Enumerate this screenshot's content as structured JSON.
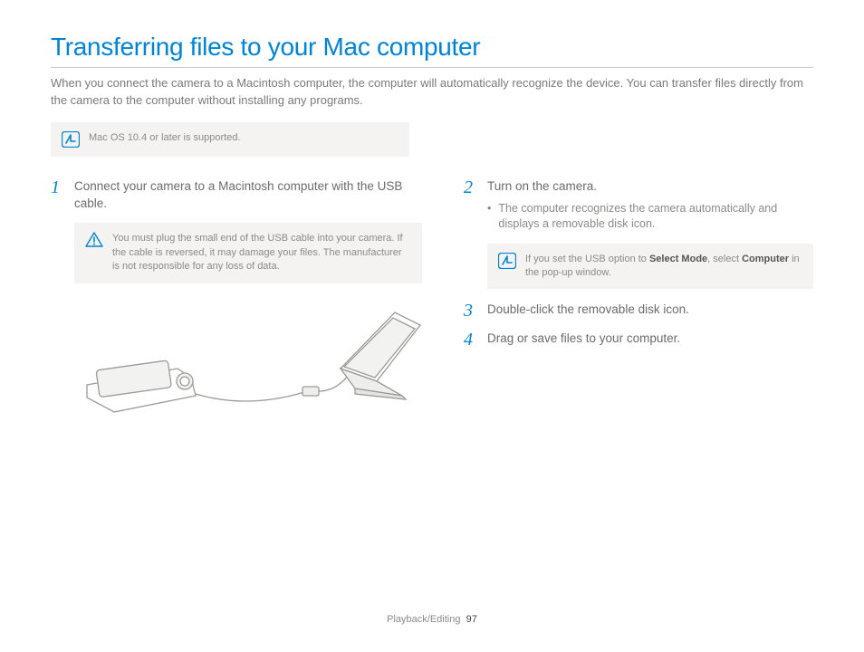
{
  "title": "Transferring files to your Mac computer",
  "intro": "When you connect the camera to a Macintosh computer, the computer will automatically recognize the device. You can transfer files directly from the camera to the computer without installing any programs.",
  "top_note": "Mac OS 10.4 or later is supported.",
  "left": {
    "step1_num": "1",
    "step1_text": "Connect your camera to a Macintosh computer with the USB cable.",
    "caution_text": "You must plug the small end of the USB cable into your camera. If the cable is reversed, it may damage your files. The manufacturer is not responsible for any loss of data."
  },
  "right": {
    "step2_num": "2",
    "step2_text": "Turn on the camera.",
    "step2_sub": "The computer recognizes the camera automatically and displays a removable disk icon.",
    "note2_pre": "If you set the USB option to ",
    "note2_b1": "Select Mode",
    "note2_mid": ", select ",
    "note2_b2": "Computer",
    "note2_post": " in the pop-up window.",
    "step3_num": "3",
    "step3_text": "Double-click the removable disk icon.",
    "step4_num": "4",
    "step4_text": "Drag or save files to your computer."
  },
  "footer_section": "Playback/Editing",
  "footer_page": "97"
}
